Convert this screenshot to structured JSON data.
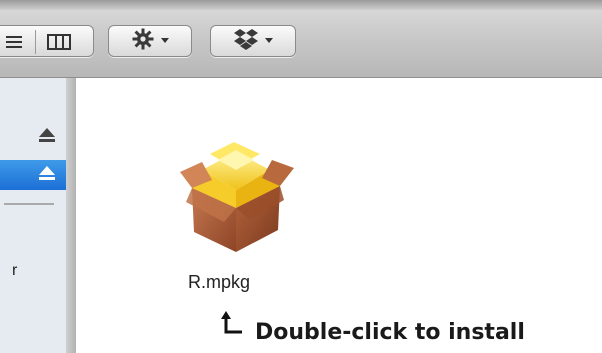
{
  "toolbar": {
    "view_buttons": [
      {
        "icon": "list-view-icon"
      },
      {
        "icon": "column-view-icon"
      }
    ],
    "action_button": {
      "icon": "gear-icon",
      "menu": "chevron-down-icon"
    },
    "dropbox_button": {
      "icon": "dropbox-icon",
      "menu": "chevron-down-icon"
    }
  },
  "sidebar": {
    "items": [
      {
        "icon": "eject-icon",
        "selected": false
      },
      {
        "icon": "eject-icon",
        "selected": true
      }
    ],
    "truncated_label": "r"
  },
  "file": {
    "name": "R.mpkg",
    "icon": "package-icon"
  },
  "instruction": {
    "arrow_icon": "arrow-up-icon",
    "text": "Double-click to install"
  },
  "colors": {
    "selection": "#2a7fe0",
    "toolbar": "#c6c6c6",
    "sidebar": "#e6ebf2"
  }
}
